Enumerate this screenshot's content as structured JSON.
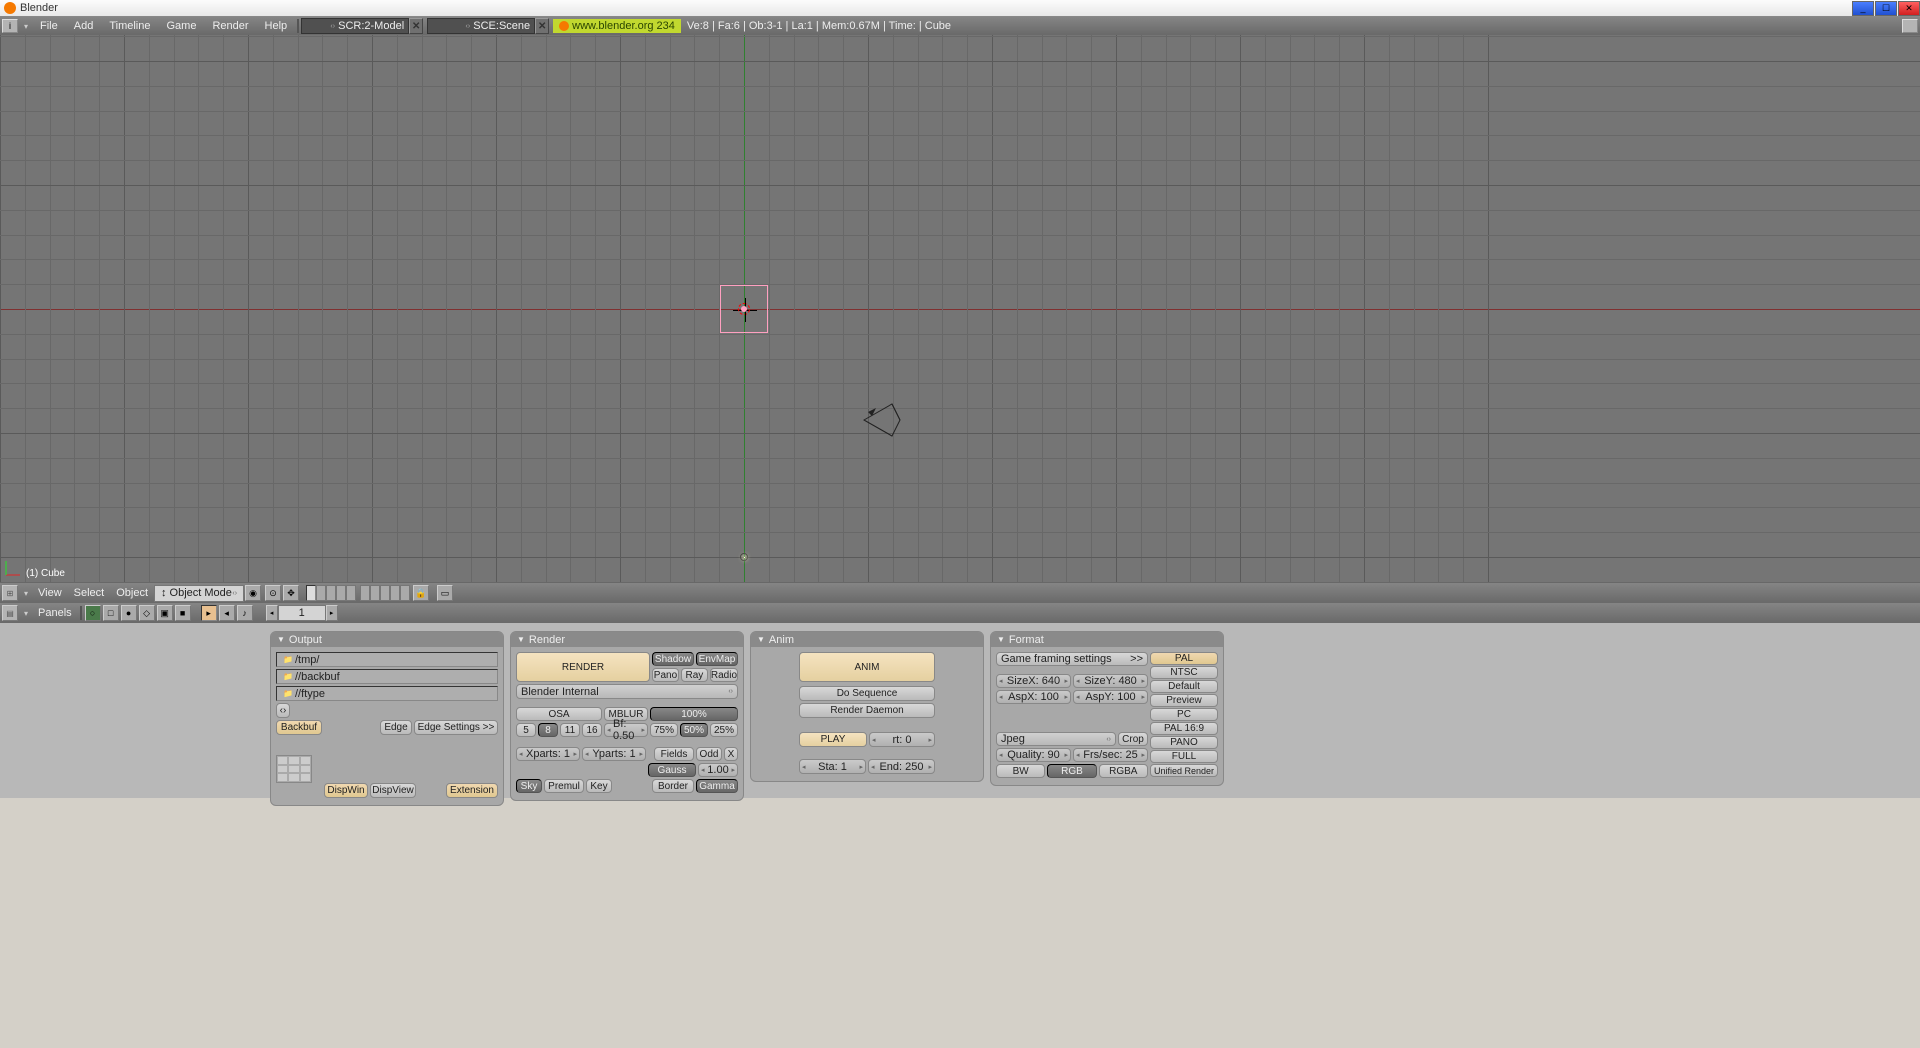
{
  "titlebar": {
    "text": "Blender"
  },
  "mainmenu": {
    "icon_label": "i",
    "items": [
      "File",
      "Add",
      "Timeline",
      "Game",
      "Render",
      "Help"
    ],
    "scr_dropdown": "SCR:2-Model",
    "sce_dropdown": "SCE:Scene",
    "url": "www.blender.org 234",
    "stats": "Ve:8 | Fa:6 | Ob:3-1 | La:1 | Mem:0.67M | Time: | Cube"
  },
  "viewport": {
    "object_label": "(1) Cube"
  },
  "header3d": {
    "menus": [
      "View",
      "Select",
      "Object"
    ],
    "mode": "Object Mode"
  },
  "buttonshdr": {
    "label": "Panels",
    "frame": "1"
  },
  "panels": {
    "output": {
      "title": "Output",
      "path1": "/tmp/",
      "path2": "//backbuf",
      "path3": "//ftype",
      "backbuf": "Backbuf",
      "edge": "Edge",
      "edge_settings": "Edge Settings >>",
      "dispwin": "DispWin",
      "dispview": "DispView",
      "extension": "Extension"
    },
    "render": {
      "title": "Render",
      "render_btn": "RENDER",
      "engine": "Blender Internal",
      "shadow": "Shadow",
      "envmap": "EnvMap",
      "pano": "Pano",
      "ray": "Ray",
      "radio": "Radio",
      "osa": "OSA",
      "mblur": "MBLUR",
      "pct_100": "100%",
      "osa5": "5",
      "osa8": "8",
      "osa11": "11",
      "osa16": "16",
      "bf": "Bf: 0.50",
      "p75": "75%",
      "p50": "50%",
      "p25": "25%",
      "xparts": "Xparts: 1",
      "yparts": "Yparts: 1",
      "fields": "Fields",
      "odd": "Odd",
      "x": "X",
      "gauss": "Gauss",
      "gauss_val": "1.00",
      "sky": "Sky",
      "premul": "Premul",
      "key": "Key",
      "border": "Border",
      "gamma": "Gamma"
    },
    "anim": {
      "title": "Anim",
      "anim_btn": "ANIM",
      "do_seq": "Do Sequence",
      "daemon": "Render Daemon",
      "play": "PLAY",
      "rt": "rt: 0",
      "sta": "Sta: 1",
      "end": "End: 250"
    },
    "format": {
      "title": "Format",
      "game": "Game framing settings",
      "game_arrow": ">>",
      "sizex": "SizeX: 640",
      "sizey": "SizeY: 480",
      "aspx": "AspX: 100",
      "aspy": "AspY: 100",
      "jpeg": "Jpeg",
      "crop": "Crop",
      "quality": "Quality: 90",
      "fps": "Frs/sec: 25",
      "bw": "BW",
      "rgb": "RGB",
      "rgba": "RGBA",
      "pal": "PAL",
      "ntsc": "NTSC",
      "default": "Default",
      "preview": "Preview",
      "pc": "PC",
      "pal169": "PAL 16:9",
      "pano": "PANO",
      "full": "FULL",
      "unified": "Unified Render"
    }
  }
}
